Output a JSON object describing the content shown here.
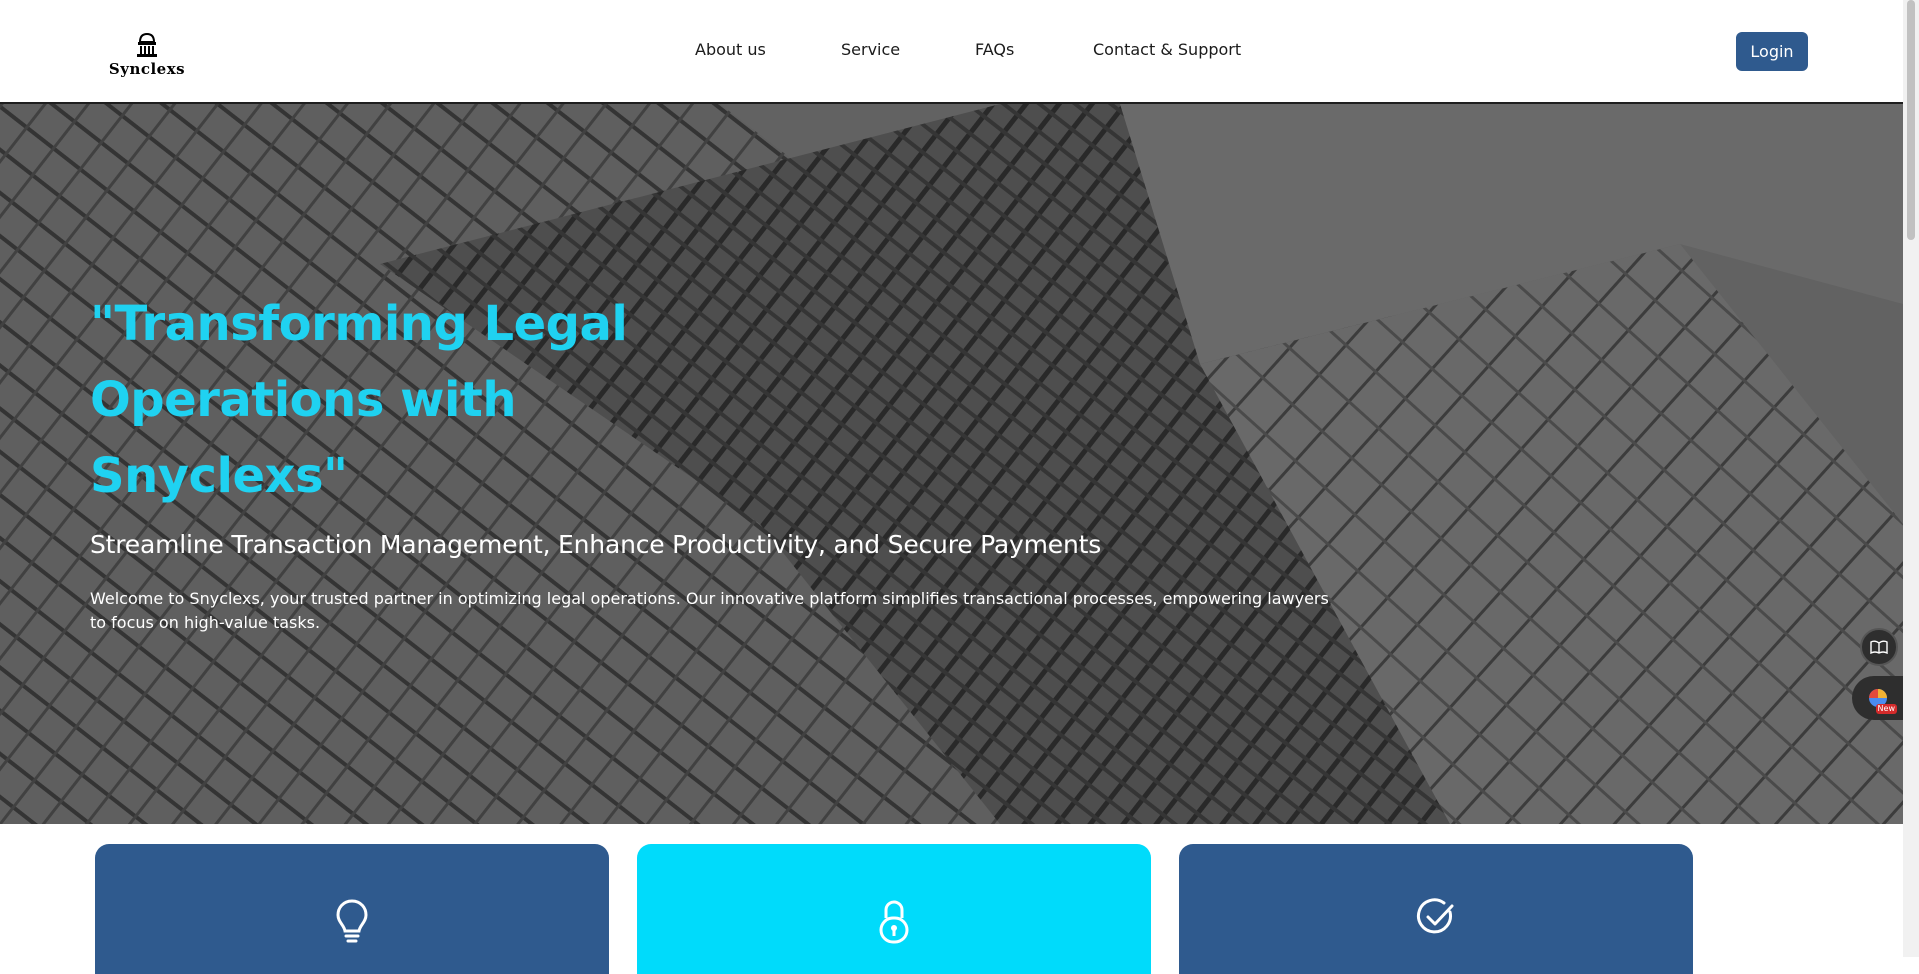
{
  "header": {
    "logo_text": "Synclexs",
    "nav": [
      {
        "label": "About us"
      },
      {
        "label": "Service"
      },
      {
        "label": "FAQs"
      },
      {
        "label": "Contact & Support"
      }
    ],
    "login_label": "Login"
  },
  "hero": {
    "title": "\"Transforming Legal Operations with Snyclexs\"",
    "subtitle": "Streamline Transaction Management, Enhance Productivity, and Secure Payments",
    "description": "Welcome to Snyclexs, your trusted partner in optimizing legal operations. Our innovative platform simplifies transactional processes, empowering lawyers to focus on high-value tasks."
  },
  "side_widgets": {
    "new_badge": "New"
  },
  "cards": [
    {
      "icon": "lightbulb-icon"
    },
    {
      "icon": "lock-icon"
    },
    {
      "icon": "check-circle-icon"
    }
  ],
  "colors": {
    "accent": "#1fd2f1",
    "primary": "#2f5a8e",
    "card_cyan": "#00dbfb"
  }
}
